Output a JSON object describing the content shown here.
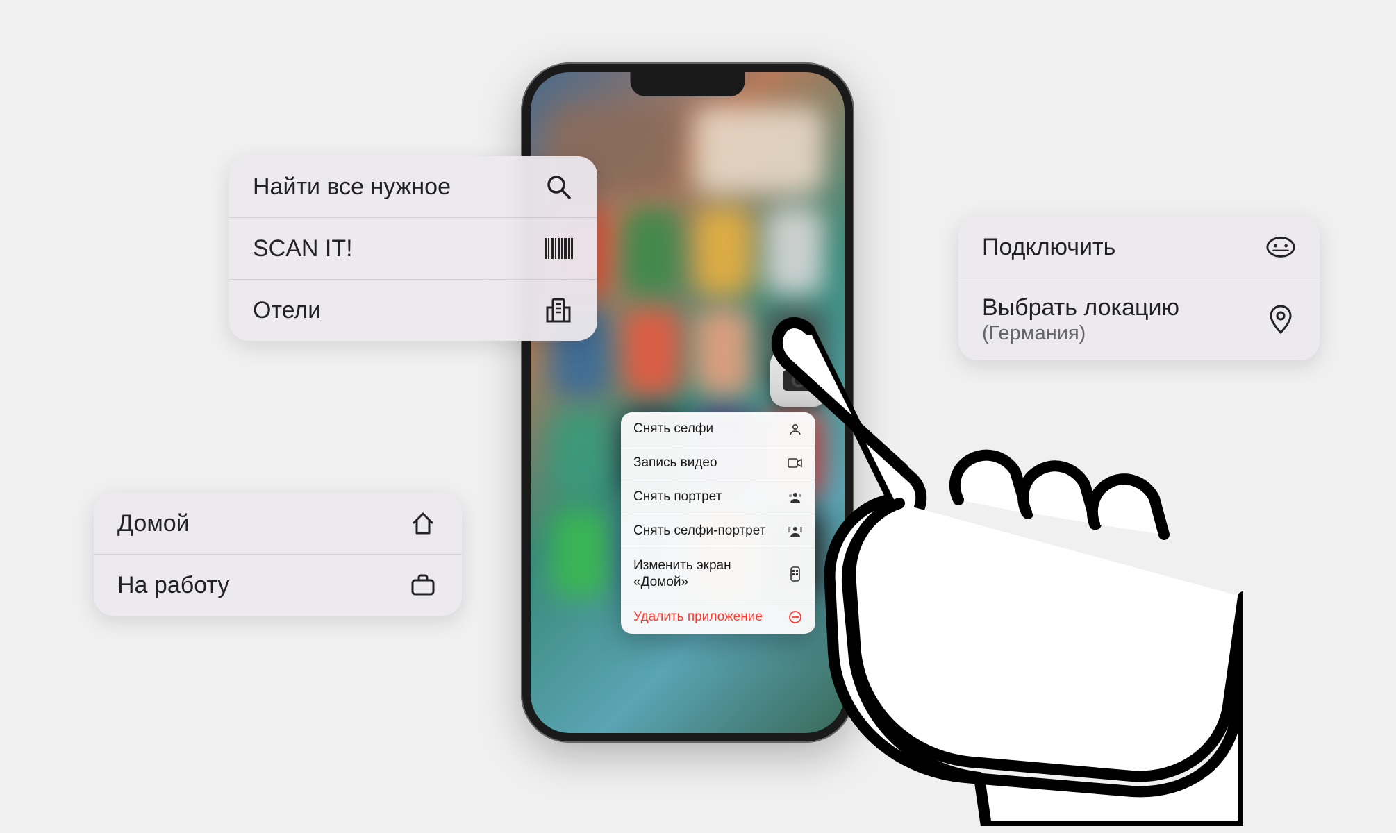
{
  "cards": {
    "topLeft": {
      "items": [
        {
          "label": "Найти все нужное",
          "icon": "search"
        },
        {
          "label": "SCAN IT!",
          "icon": "barcode"
        },
        {
          "label": "Отели",
          "icon": "building"
        }
      ]
    },
    "bottomLeft": {
      "items": [
        {
          "label": "Домой",
          "icon": "home"
        },
        {
          "label": "На работу",
          "icon": "briefcase"
        }
      ]
    },
    "right": {
      "items": [
        {
          "label": "Подключить",
          "sublabel": "",
          "icon": "vpn-face"
        },
        {
          "label": "Выбрать локацию",
          "sublabel": "(Германия)",
          "icon": "pin"
        }
      ]
    }
  },
  "contextMenu": {
    "items": [
      {
        "label": "Снять селфи",
        "icon": "selfie",
        "danger": false
      },
      {
        "label": "Запись видео",
        "icon": "video",
        "danger": false
      },
      {
        "label": "Снять портрет",
        "icon": "portrait",
        "danger": false
      },
      {
        "label": "Снять селфи-портрет",
        "icon": "selfie-portrait",
        "danger": false
      },
      {
        "label": "Изменить экран «Домой»",
        "icon": "homescreen",
        "danger": false
      },
      {
        "label": "Удалить приложение",
        "icon": "remove",
        "danger": true
      }
    ]
  }
}
